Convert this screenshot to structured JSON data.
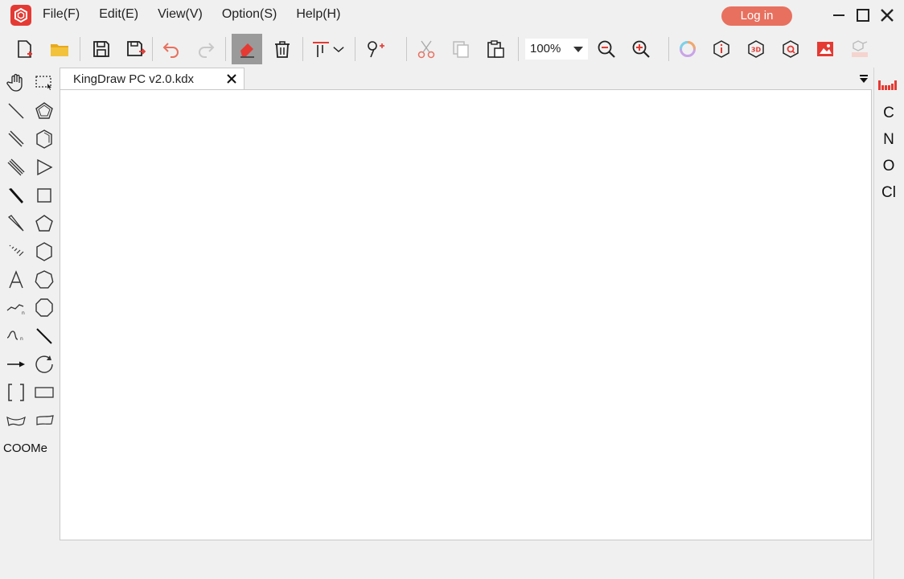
{
  "window": {
    "menu": [
      {
        "key": "file",
        "label": "File(F)"
      },
      {
        "key": "edit",
        "label": "Edit(E)"
      },
      {
        "key": "view",
        "label": "View(V)"
      },
      {
        "key": "option",
        "label": "Option(S)"
      },
      {
        "key": "help",
        "label": "Help(H)"
      }
    ],
    "login_label": "Log in",
    "accent_color": "#e43a33"
  },
  "toolbar": {
    "zoom_value": "100%"
  },
  "left_tools": {
    "coome_label": "COOMe"
  },
  "document": {
    "tab_title": "KingDraw PC v2.0.kdx"
  },
  "elements": {
    "items": [
      "C",
      "N",
      "O",
      "Cl"
    ]
  }
}
